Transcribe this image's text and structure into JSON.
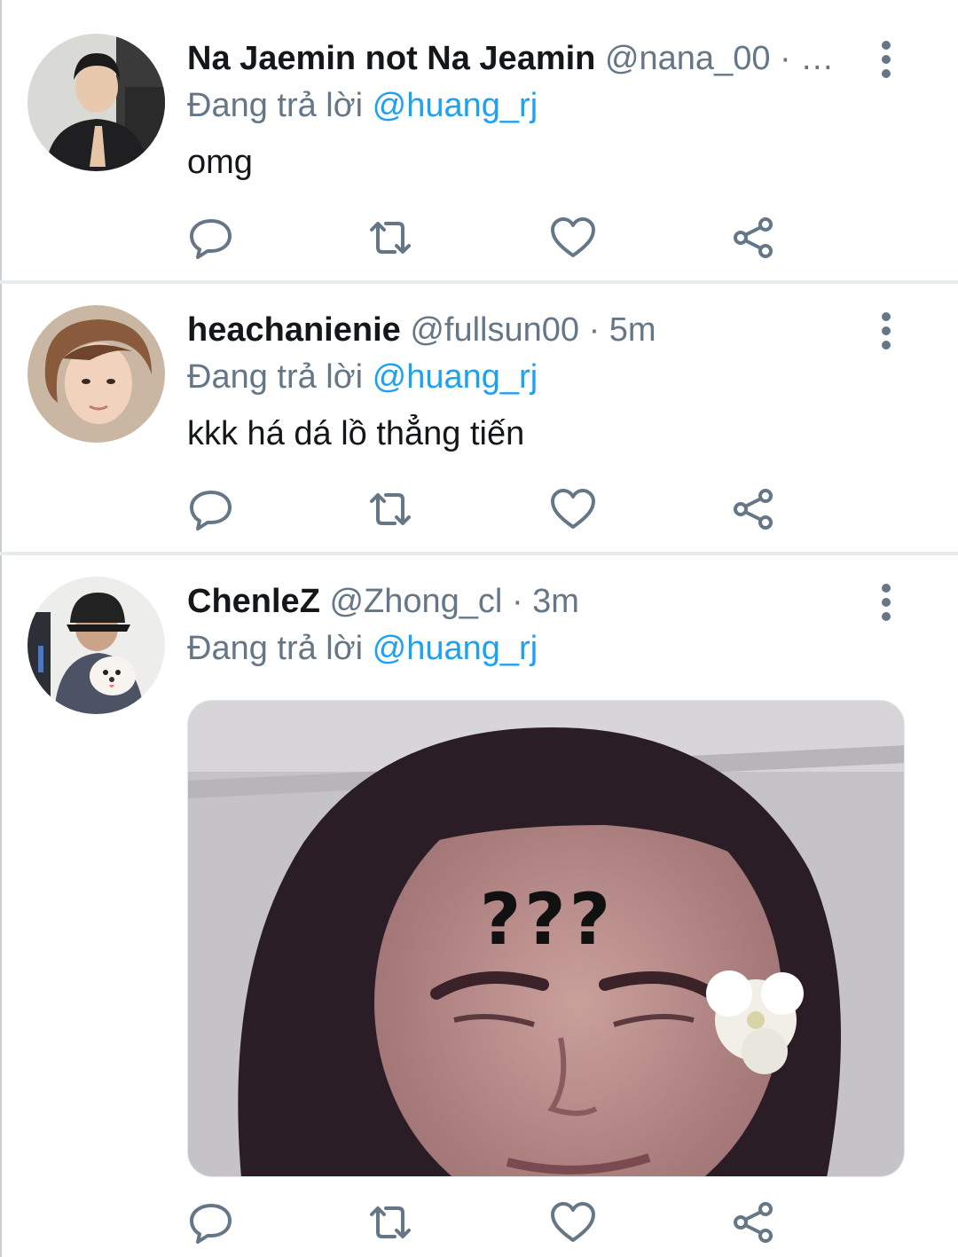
{
  "colors": {
    "text_primary": "#14171a",
    "text_secondary": "#657786",
    "mention": "#1da1f2",
    "divider": "#e6ecf0"
  },
  "reply_prefix": "Đang trả lời",
  "tweets": [
    {
      "name": "Na Jaemin not Na Jeamin",
      "handle": "@nana_00",
      "separator": "·",
      "time": "…",
      "reply_to": "@huang_rj",
      "text": "omg",
      "avatar_icon": "user-avatar"
    },
    {
      "name": "heachanienie",
      "handle": "@fullsun00",
      "separator": "·",
      "time": "5m",
      "reply_to": "@huang_rj",
      "text": "kkk há dá lồ thẳng tiến",
      "avatar_icon": "user-avatar"
    },
    {
      "name": "ChenleZ",
      "handle": "@Zhong_cl",
      "separator": "·",
      "time": "3m",
      "reply_to": "@huang_rj",
      "media_caption": "???",
      "avatar_icon": "user-avatar"
    }
  ],
  "action_icons": [
    "reply-icon",
    "retweet-icon",
    "like-icon",
    "share-icon"
  ]
}
